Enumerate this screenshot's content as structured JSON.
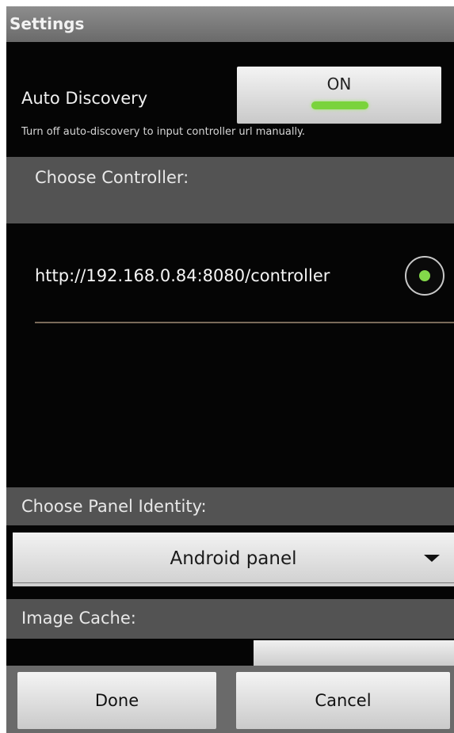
{
  "titlebar": {
    "title": "Settings"
  },
  "auto_discovery": {
    "label": "Auto Discovery",
    "toggle_text": "ON",
    "hint": "Turn off auto-discovery to input controller url manually.",
    "indicator_color": "#7ad33c"
  },
  "controller": {
    "header": "Choose Controller:",
    "items": [
      {
        "url": "http://192.168.0.84:8080/controller",
        "selected": true
      }
    ]
  },
  "panel": {
    "header": "Choose Panel Identity:",
    "selected": "Android panel",
    "arrow_icon": "dropdown-arrow-icon"
  },
  "cache": {
    "header": "Image Cache:",
    "button_label": ""
  },
  "actions": {
    "done": "Done",
    "cancel": "Cancel"
  }
}
